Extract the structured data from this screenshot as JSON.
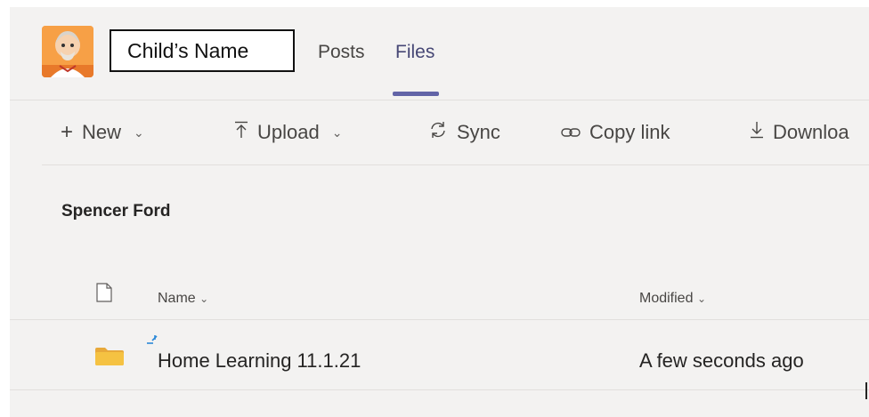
{
  "header": {
    "team_name": "Child’s Name",
    "tabs": [
      {
        "label": "Posts",
        "active": false
      },
      {
        "label": "Files",
        "active": true
      }
    ]
  },
  "toolbar": {
    "items": [
      {
        "label": "New",
        "icon": "plus-icon",
        "has_dropdown": true
      },
      {
        "label": "Upload",
        "icon": "upload-icon",
        "has_dropdown": true
      },
      {
        "label": "Sync",
        "icon": "sync-icon",
        "has_dropdown": false
      },
      {
        "label": "Copy link",
        "icon": "link-icon",
        "has_dropdown": false
      },
      {
        "label": "Downloa",
        "icon": "download-icon",
        "has_dropdown": false
      }
    ]
  },
  "breadcrumb": "Spencer Ford",
  "file_list": {
    "columns": [
      {
        "label": "Name",
        "sortable": true
      },
      {
        "label": "Modified",
        "sortable": true
      }
    ],
    "rows": [
      {
        "name": "Home Learning 11.1.21",
        "modified": "A few seconds ago",
        "type": "folder",
        "new": true
      }
    ]
  },
  "colors": {
    "accent": "#6264a7",
    "active_tab_text": "#464775",
    "folder": "#f5c242",
    "new_indicator": "#2b88d8",
    "surface": "#f3f2f1"
  }
}
